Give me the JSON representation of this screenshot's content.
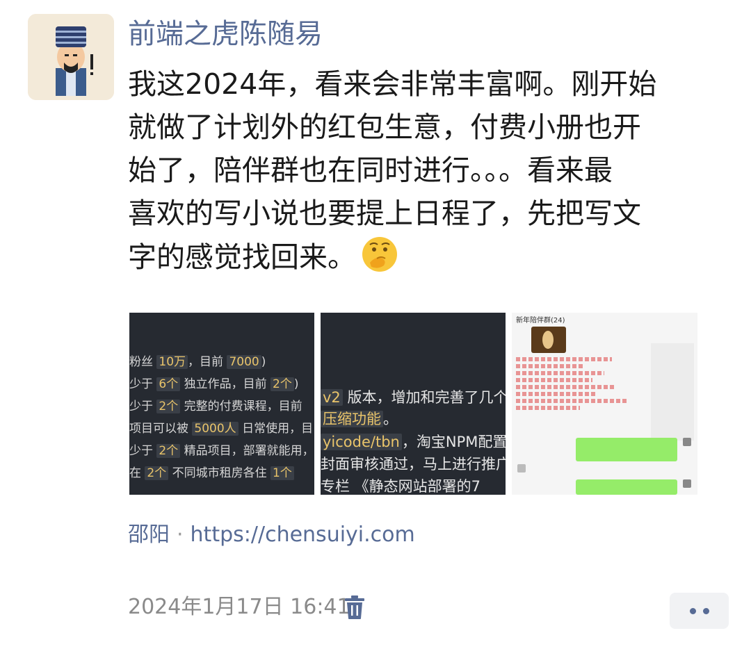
{
  "author": {
    "name": "前端之虎陈随易"
  },
  "post": {
    "lines": [
      "我这2024年，看来会非常丰富啊。刚开始",
      "就做了计划外的红包生意，付费小册也开",
      "始了，陪伴群也在同时进行。。。看来最",
      "喜欢的写小说也要提上日程了，先把写文",
      "字的感觉找回来。"
    ],
    "emoji": "thinking-face-emoji"
  },
  "images": [
    {
      "lines": [
        [
          "粉丝 ",
          "10万",
          "，目前 ",
          "7000",
          ")"
        ],
        [
          "少于 ",
          "6个",
          " 独立作品，目前 ",
          "2个",
          ")"
        ],
        [
          "少于 ",
          "2个",
          " 完整的付费课程，目前",
          "",
          ""
        ],
        [
          "项目可以被 ",
          "5000人",
          " 日常使用，目",
          "",
          ""
        ],
        [
          "少于 ",
          "2个",
          " 精品项目，部署就能用，",
          "",
          ""
        ],
        [
          "在 ",
          "2个",
          " 不同城市租房各住 ",
          "1个",
          ""
        ]
      ]
    },
    {
      "lines": [
        [
          "",
          "v2",
          " 版本，增加和完善了几个",
          "",
          ""
        ],
        [
          "压缩功能",
          "",
          "。",
          "",
          ""
        ],
        [
          "yicode/tbn",
          "",
          "，淘宝NPM配置二",
          "",
          ""
        ],
        [
          "封面审核通过，马上进行推广",
          "",
          "",
          "",
          ""
        ],
        [
          "",
          "",
          "专栏 《静态网站部署的7",
          "",
          ""
        ]
      ]
    },
    {
      "chat_title": "新年陪伴群(24)"
    }
  ],
  "source": {
    "location": "邵阳",
    "separator": "·",
    "url": "https://chensuiyi.com"
  },
  "timestamp": "2024年1月17日 16:41",
  "colors": {
    "link": "#576b95",
    "meta": "#8a8a8a",
    "text": "#1a1a1a"
  }
}
